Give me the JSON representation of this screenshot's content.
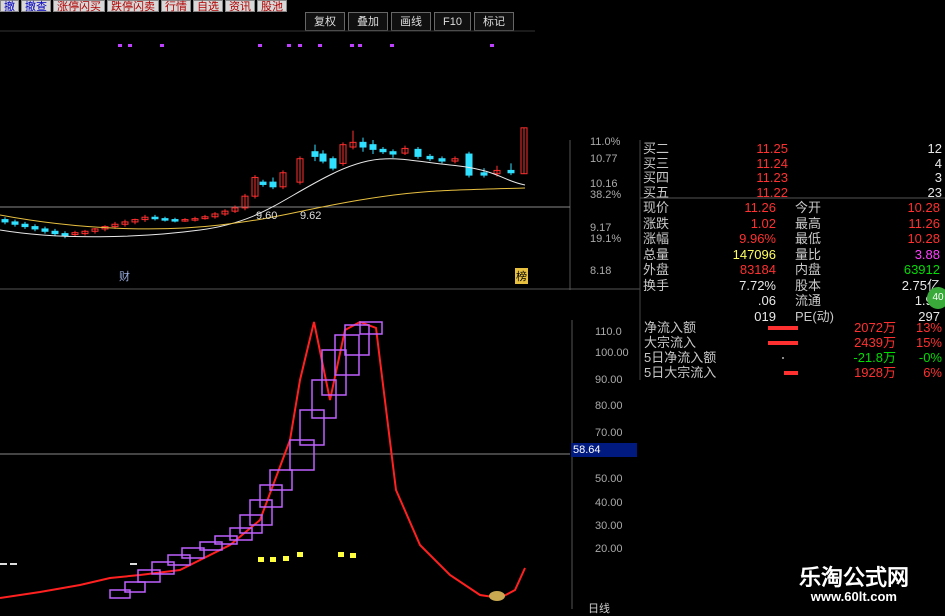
{
  "toolbar": {
    "buttons": [
      "撤",
      "撤查",
      "涨停闪买",
      "跌停闪卖",
      "行情",
      "自选",
      "资讯",
      "股池"
    ]
  },
  "subbar": {
    "buttons": [
      "复权",
      "叠加",
      "画线",
      "F10",
      "标记"
    ]
  },
  "kline": {
    "axis": [
      "11.0%",
      "10.77",
      "10.16",
      "38.2%",
      "9.17",
      "19.1%",
      "8.18"
    ],
    "annot": [
      "9.60",
      "9.62"
    ],
    "markers": [
      "财",
      "榜"
    ]
  },
  "quote": {
    "bids": [
      {
        "label": "买二",
        "price": "11.25",
        "vol": "12"
      },
      {
        "label": "买三",
        "price": "11.24",
        "vol": "4"
      },
      {
        "label": "买四",
        "price": "11.23",
        "vol": "3"
      },
      {
        "label": "买五",
        "price": "11.22",
        "vol": "23"
      }
    ],
    "stats": [
      {
        "l1": "现价",
        "v1": "11.26",
        "l2": "今开",
        "v2": "10.28"
      },
      {
        "l1": "涨跌",
        "v1": "1.02",
        "l2": "最高",
        "v2": "11.26"
      },
      {
        "l1": "涨幅",
        "v1": "9.96%",
        "l2": "最低",
        "v2": "10.28"
      },
      {
        "l1": "总量",
        "v1": "147096",
        "l2": "量比",
        "v2": "3.88"
      },
      {
        "l1": "外盘",
        "v1": "83184",
        "l2": "内盘",
        "v2": "63912"
      },
      {
        "l1": "换手",
        "v1": "7.72%",
        "l2": "股本",
        "v2": "2.75亿"
      },
      {
        "l1": "",
        "v1": ".06",
        "l2": "流通",
        "v2": "1.91"
      },
      {
        "l1": "",
        "v1": "019",
        "l2": "PE(动)",
        "v2": "297"
      }
    ],
    "flows": [
      {
        "label": "净流入额",
        "value": "2072万",
        "pct": "13%"
      },
      {
        "label": "大宗流入",
        "value": "2439万",
        "pct": "15%"
      },
      {
        "label": "5日净流入额",
        "value": "-21.8万",
        "pct": "-0%"
      },
      {
        "label": "5日大宗流入",
        "value": "1928万",
        "pct": "6%"
      }
    ],
    "badge": "40"
  },
  "indicator": {
    "axis": [
      "110.0",
      "100.00",
      "90.00",
      "80.00",
      "70.00",
      "50.00",
      "40.00",
      "30.00",
      "20.00"
    ],
    "current": "58.64",
    "period": "日线"
  },
  "brand": {
    "name": "乐淘公式网",
    "url": "www.60lt.com"
  },
  "colors": {
    "up": "#ff3030",
    "down": "#30e0ff",
    "ma_short": "#e8e8e8",
    "ma_long": "#e8c040",
    "line": "#ff2020",
    "box": "#c060ff",
    "dot": "#ffff40"
  }
}
